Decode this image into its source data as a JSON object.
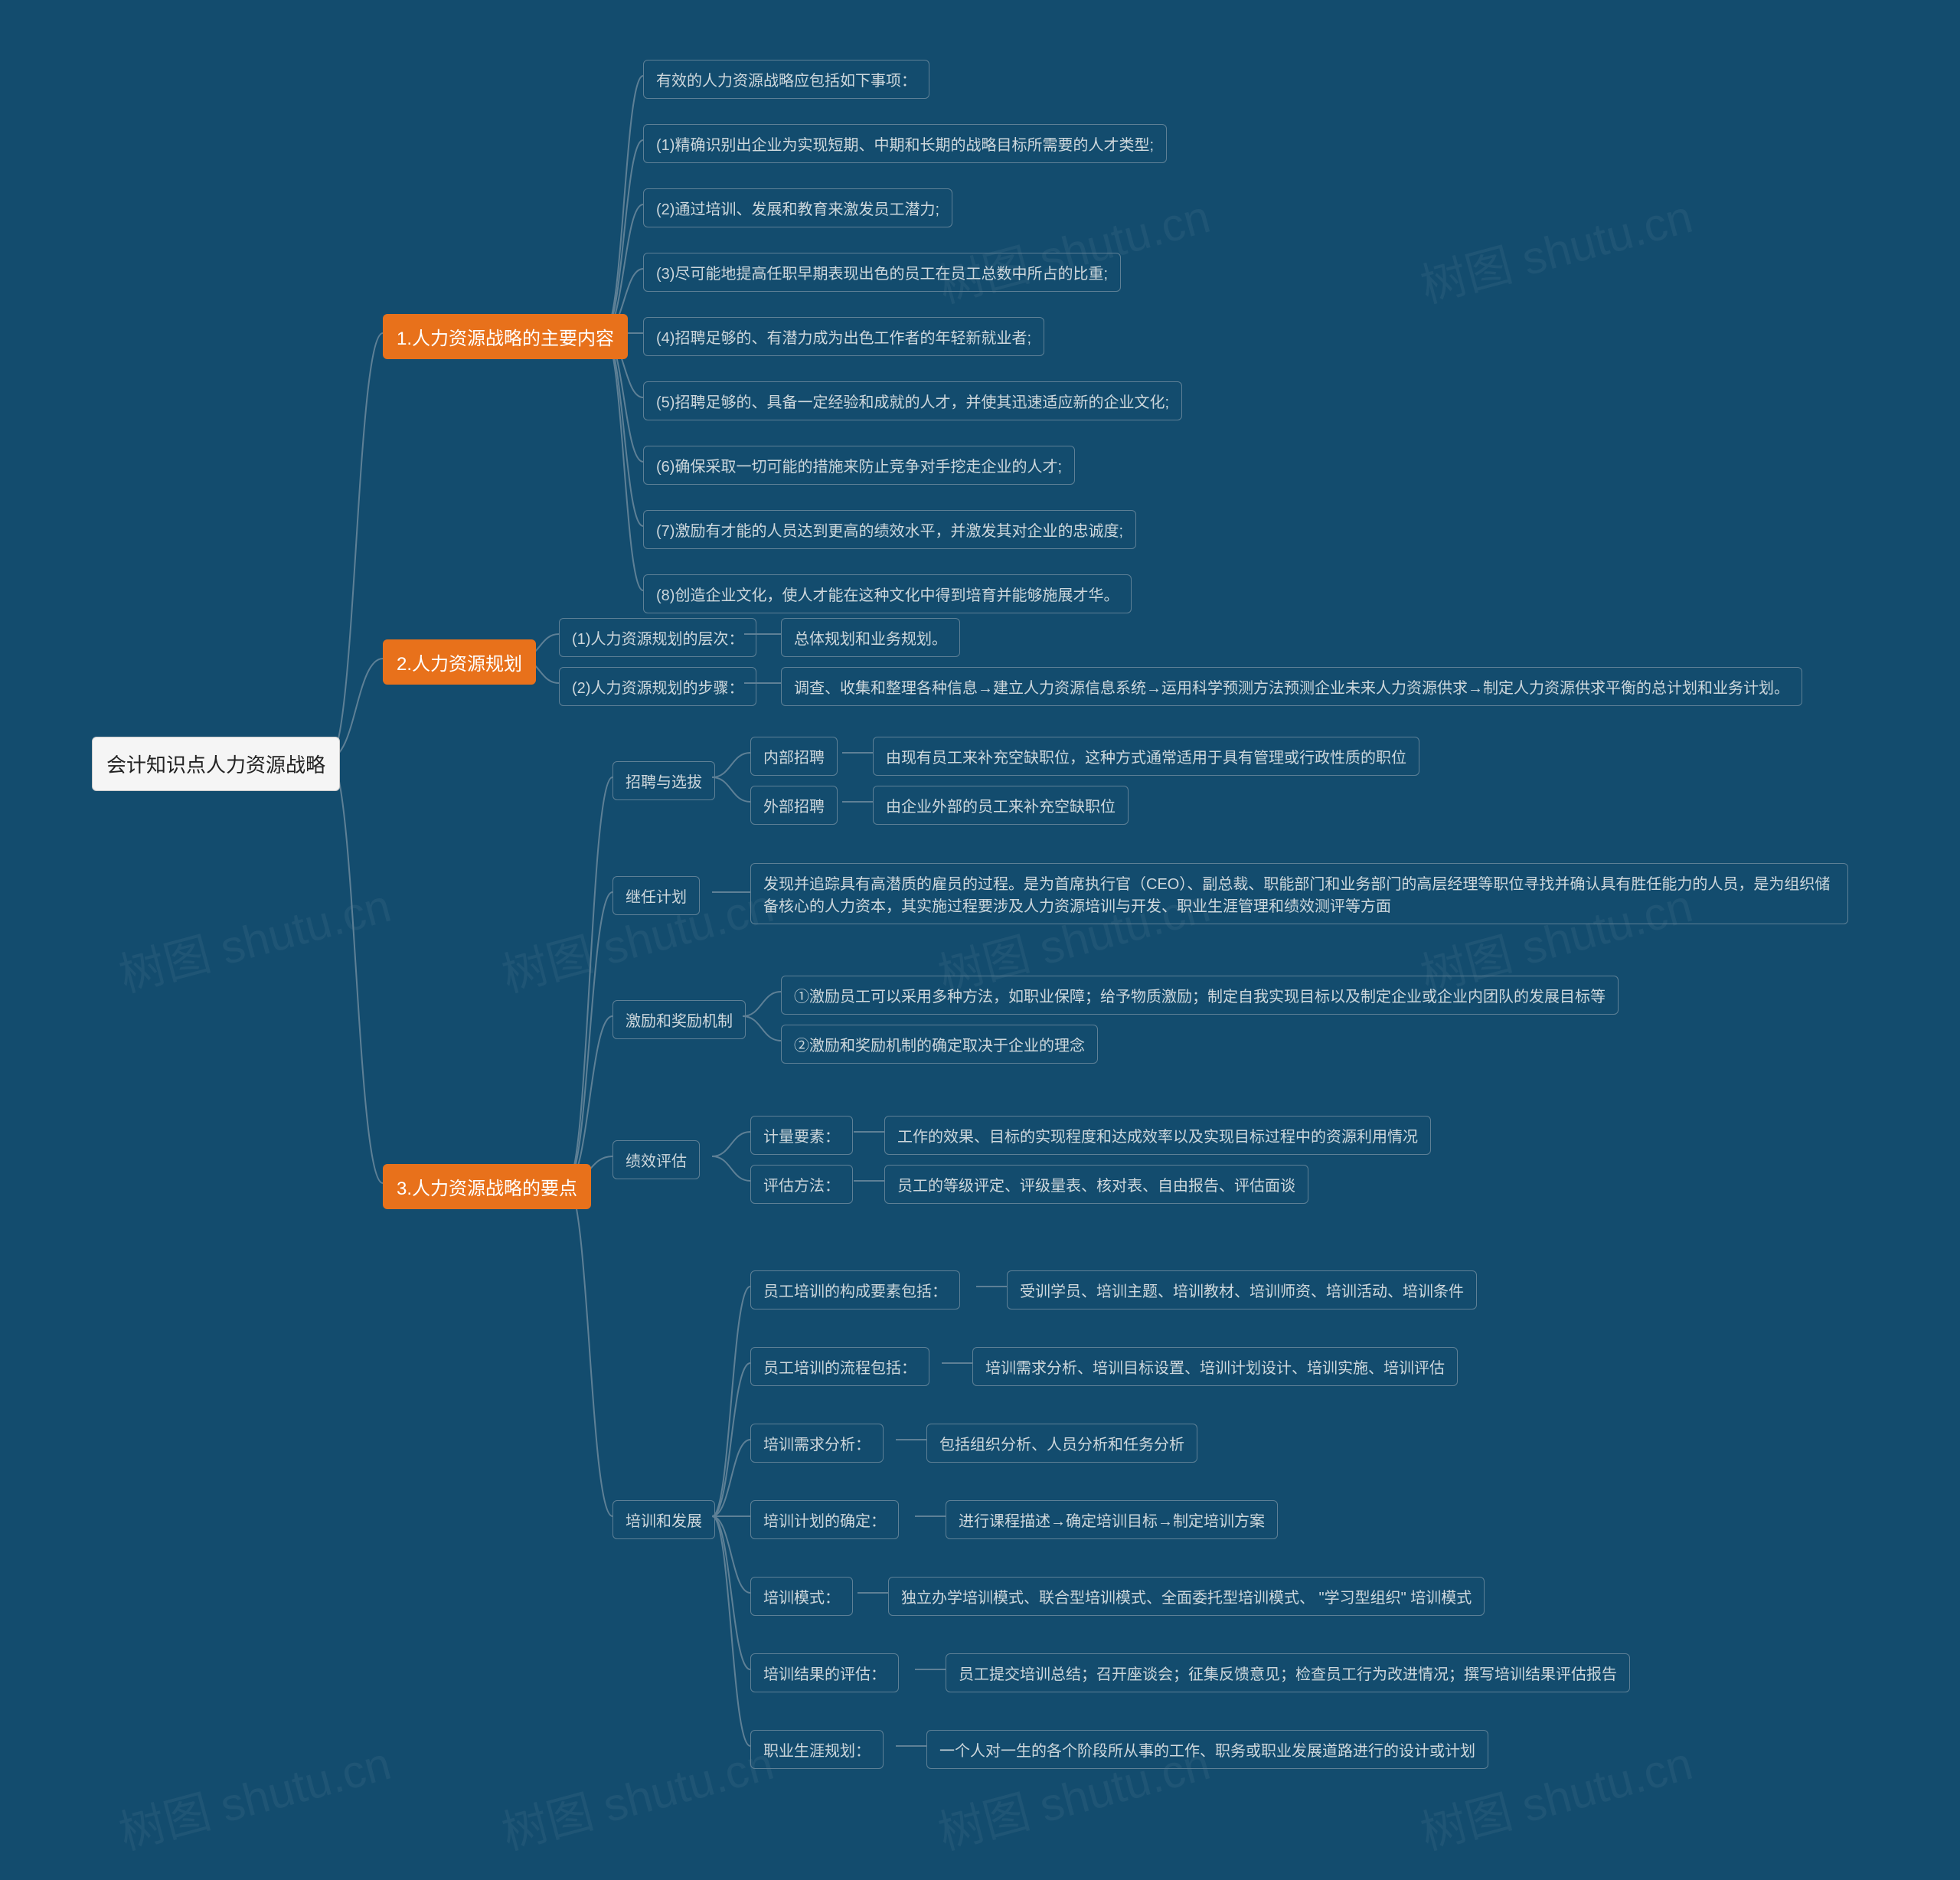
{
  "root": {
    "label": "会计知识点人力资源战略"
  },
  "b1": {
    "label": "1.人力资源战略的主要内容"
  },
  "b1_items": [
    "有效的人力资源战略应包括如下事项：",
    "(1)精确识别出企业为实现短期、中期和长期的战略目标所需要的人才类型;",
    "(2)通过培训、发展和教育来激发员工潜力;",
    "(3)尽可能地提高任职早期表现出色的员工在员工总数中所占的比重;",
    "(4)招聘足够的、有潜力成为出色工作者的年轻新就业者;",
    "(5)招聘足够的、具备一定经验和成就的人才，并使其迅速适应新的企业文化;",
    "(6)确保采取一切可能的措施来防止竞争对手挖走企业的人才;",
    "(7)激励有才能的人员达到更高的绩效水平，并激发其对企业的忠诚度;",
    "(8)创造企业文化，使人才能在这种文化中得到培育并能够施展才华。"
  ],
  "b2": {
    "label": "2.人力资源规划"
  },
  "b2_1": {
    "label": "(1)人力资源规划的层次：",
    "child": "总体规划和业务规划。"
  },
  "b2_2": {
    "label": "(2)人力资源规划的步骤：",
    "child": "调查、收集和整理各种信息→建立人力资源信息系统→运用科学预测方法预测企业未来人力资源供求→制定人力资源供求平衡的总计划和业务计划。"
  },
  "b3": {
    "label": "3.人力资源战略的要点"
  },
  "b3_recruit": {
    "label": "招聘与选拔"
  },
  "b3_recruit_internal": {
    "label": "内部招聘",
    "child": "由现有员工来补充空缺职位，这种方式通常适用于具有管理或行政性质的职位"
  },
  "b3_recruit_external": {
    "label": "外部招聘",
    "child": "由企业外部的员工来补充空缺职位"
  },
  "b3_succession": {
    "label": "继任计划",
    "child": "发现并追踪具有高潜质的雇员的过程。是为首席执行官（CEO）、副总裁、职能部门和业务部门的高层经理等职位寻找并确认具有胜任能力的人员，是为组织储备核心的人力资本，其实施过程要涉及人力资源培训与开发、职业生涯管理和绩效测评等方面"
  },
  "b3_incentive": {
    "label": "激励和奖励机制"
  },
  "b3_incentive_items": [
    "①激励员工可以采用多种方法，如职业保障；给予物质激励；制定自我实现目标以及制定企业或企业内团队的发展目标等",
    "②激励和奖励机制的确定取决于企业的理念"
  ],
  "b3_perf": {
    "label": "绩效评估"
  },
  "b3_perf_factor": {
    "label": "计量要素：",
    "child": "工作的效果、目标的实现程度和达成效率以及实现目标过程中的资源利用情况"
  },
  "b3_perf_method": {
    "label": "评估方法：",
    "child": "员工的等级评定、评级量表、核对表、自由报告、评估面谈"
  },
  "b3_train": {
    "label": "培训和发展"
  },
  "b3_train_items": [
    {
      "label": "员工培训的构成要素包括：",
      "child": "受训学员、培训主题、培训教材、培训师资、培训活动、培训条件"
    },
    {
      "label": "员工培训的流程包括：",
      "child": "培训需求分析、培训目标设置、培训计划设计、培训实施、培训评估"
    },
    {
      "label": "培训需求分析：",
      "child": "包括组织分析、人员分析和任务分析"
    },
    {
      "label": "培训计划的确定：",
      "child": "进行课程描述→确定培训目标→制定培训方案"
    },
    {
      "label": "培训模式：",
      "child": "独立办学培训模式、联合型培训模式、全面委托型培训模式、 \"学习型组织\" 培训模式"
    },
    {
      "label": "培训结果的评估：",
      "child": "员工提交培训总结；召开座谈会；征集反馈意见；检查员工行为改进情况；撰写培训结果评估报告"
    },
    {
      "label": "职业生涯规划：",
      "child": "一个人对一生的各个阶段所从事的工作、职务或职业发展道路进行的设计或计划"
    }
  ],
  "watermark": "树图 shutu.cn"
}
